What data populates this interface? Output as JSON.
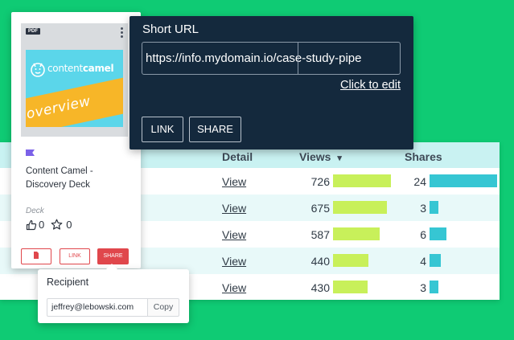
{
  "table": {
    "headers": {
      "detail": "Detail",
      "views": "Views",
      "views_sort_icon": "▾",
      "shares": "Shares"
    },
    "rows": [
      {
        "detail": "View",
        "views": "726",
        "views_value": 726,
        "shares": "24",
        "shares_value": 24
      },
      {
        "detail": "View",
        "views": "675",
        "views_value": 675,
        "shares": "3",
        "shares_value": 3
      },
      {
        "detail": "View",
        "views": "587",
        "views_value": 587,
        "shares": "6",
        "shares_value": 6
      },
      {
        "detail": "View",
        "views": "440",
        "views_value": 440,
        "shares": "4",
        "shares_value": 4
      },
      {
        "detail": "View",
        "views": "430",
        "views_value": 430,
        "shares": "3",
        "shares_value": 3
      }
    ]
  },
  "card": {
    "file_type": "PDF",
    "cover_logo_text_light": "content",
    "cover_logo_text_bold": "camel",
    "cover_band_text": "overview",
    "title": "Content Camel - Discovery Deck",
    "type": "Deck",
    "likes": "0",
    "favorites": "0",
    "actions": {
      "download_icon": "document-icon",
      "link": "LINK",
      "share": "SHARE"
    }
  },
  "recipient": {
    "label": "Recipient",
    "email": "jeffrey@lebowski.com",
    "copy": "Copy"
  },
  "short_url": {
    "title": "Short URL",
    "value": "https://info.mydomain.io/case-study-pipe",
    "edit": "Click to edit",
    "link_button": "LINK",
    "share_button": "SHARE"
  },
  "colors": {
    "background": "#0fcb74",
    "views_bar": "#c8f05a",
    "shares_bar": "#36c6d3",
    "accent_red": "#e0474c",
    "dialog_bg": "#14293d"
  }
}
